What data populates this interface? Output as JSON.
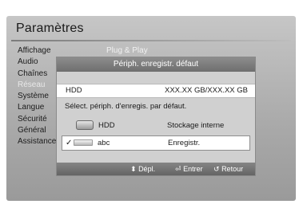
{
  "screen": {
    "title": "Paramètres",
    "menu": [
      {
        "label": "Affichage",
        "dim": false
      },
      {
        "label": "Audio",
        "dim": false
      },
      {
        "label": "Chaînes",
        "dim": false
      },
      {
        "label": "Réseau",
        "dim": true
      },
      {
        "label": "Système",
        "dim": false
      },
      {
        "label": "Langue",
        "dim": false
      },
      {
        "label": "Sécurité",
        "dim": false
      },
      {
        "label": "Général",
        "dim": false
      },
      {
        "label": "Assistance",
        "dim": false
      }
    ],
    "submenu_hint": "Plug & Play"
  },
  "dialog": {
    "title": "Périph. enregistr. défaut",
    "hdd_label": "HDD",
    "hdd_capacity": "XXX.XX GB/XXX.XX GB",
    "instruction": "Sélect. périph. d'enregis. par défaut.",
    "options": [
      {
        "name": "HDD",
        "description": "Stockage interne",
        "checked": false,
        "icon": "hard-disk-icon"
      },
      {
        "name": "abc",
        "description": "Enregistr.",
        "checked": true,
        "icon": "usb-drive-icon"
      }
    ],
    "check_mark": "✓",
    "footer": {
      "move": "Dépl.",
      "move_icon": "⬍",
      "enter": "Entrer",
      "enter_icon": "⏎",
      "back": "Retour",
      "back_icon": "↺"
    }
  },
  "colors": {
    "panel_bg": "#a9a9a9",
    "header_bg": "#7a7a7a",
    "dialog_bg": "#d0d0d0",
    "selected_row_bg": "#ffffff"
  }
}
